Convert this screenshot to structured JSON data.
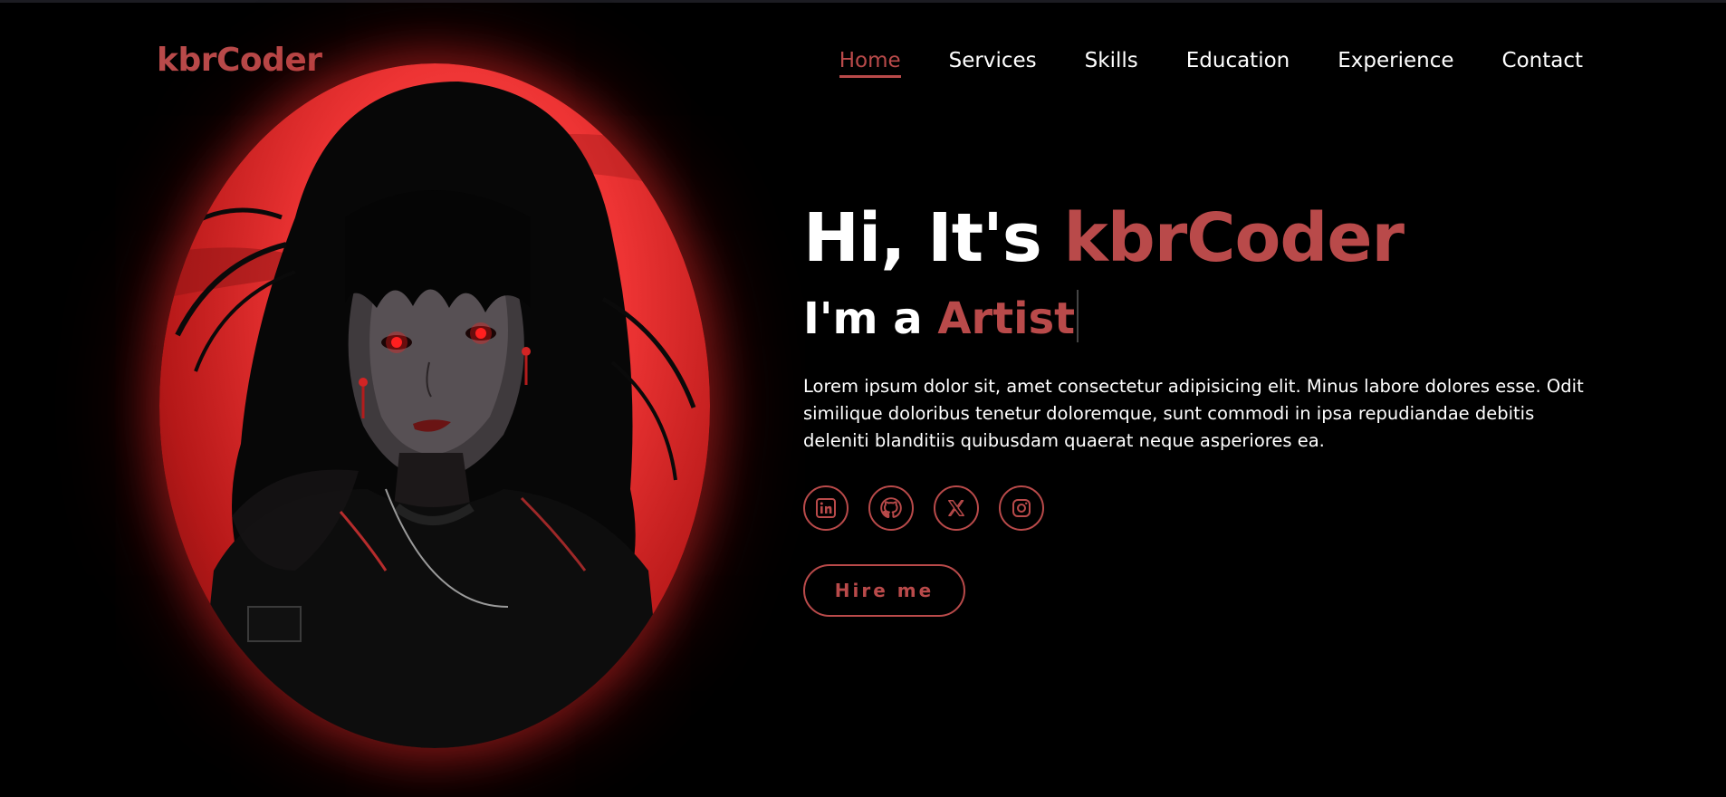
{
  "colors": {
    "accent": "#b94a4a",
    "background": "#000000",
    "glow": "#ee3434"
  },
  "header": {
    "logo": "kbrCoder",
    "nav": [
      {
        "label": "Home",
        "active": true
      },
      {
        "label": "Services",
        "active": false
      },
      {
        "label": "Skills",
        "active": false
      },
      {
        "label": "Education",
        "active": false
      },
      {
        "label": "Experience",
        "active": false
      },
      {
        "label": "Contact",
        "active": false
      }
    ]
  },
  "hero": {
    "greeting": "Hi, It's ",
    "name": "kbrCoder",
    "role_prefix": "I'm a ",
    "role": "Artist",
    "description": "Lorem ipsum dolor sit, amet consectetur adipisicing elit. Minus labore dolores esse. Odit similique doloribus tenetur doloremque, sunt commodi in ipsa repudiandae debitis deleniti blanditiis quibusdam quaerat neque asperiores ea.",
    "socials": [
      {
        "icon": "linkedin-icon"
      },
      {
        "icon": "github-icon"
      },
      {
        "icon": "x-twitter-icon"
      },
      {
        "icon": "instagram-icon"
      }
    ],
    "cta_label": "Hire me"
  }
}
